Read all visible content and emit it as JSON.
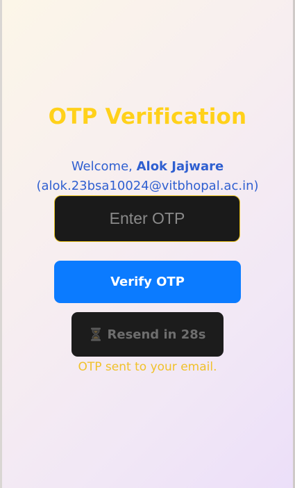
{
  "title": "OTP Verification",
  "welcome": {
    "prefix": "Welcome, ",
    "name": "Alok Jajware",
    "email": "(alok.23bsa10024@vitbhopal.ac.in)"
  },
  "otp_field": {
    "placeholder": "Enter OTP",
    "value": ""
  },
  "verify_button": {
    "label": "Verify OTP"
  },
  "resend_button": {
    "icon": "hourglass-icon",
    "label": "Resend in 28s"
  },
  "status": {
    "message": "OTP sent to your email."
  },
  "colors": {
    "title": "#ffd11a",
    "welcome_text": "#2f5fd0",
    "verify_button": "#0b7bff",
    "dark_field": "#1a1a1a",
    "status_text": "#f0c12a"
  }
}
